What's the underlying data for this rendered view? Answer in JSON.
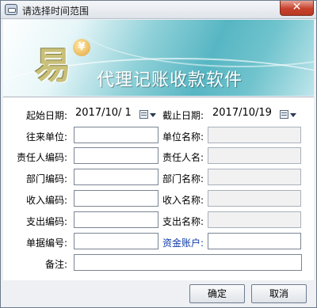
{
  "window": {
    "title": "请选择时间范围",
    "close_label": "✕"
  },
  "banner": {
    "logo_glyph": "易",
    "coin_glyph": "¥",
    "product_name": "代理记账收款软件"
  },
  "form": {
    "start_date_label": "起始日期:",
    "start_date_value": "2017/10/ 1",
    "end_date_label": "截止日期:",
    "end_date_value": "2017/10/19",
    "contact_unit_label": "往来单位:",
    "contact_unit_value": "",
    "unit_name_label": "单位名称:",
    "unit_name_value": "",
    "owner_code_label": "责任人编码:",
    "owner_code_value": "",
    "owner_name_label": "责任人名:",
    "owner_name_value": "",
    "dept_code_label": "部门编码:",
    "dept_code_value": "",
    "dept_name_label": "部门名称:",
    "dept_name_value": "",
    "income_code_label": "收入编码:",
    "income_code_value": "",
    "income_name_label": "收入名称:",
    "income_name_value": "",
    "expense_code_label": "支出编码:",
    "expense_code_value": "",
    "expense_name_label": "支出名称:",
    "expense_name_value": "",
    "doc_no_label": "单据编号:",
    "doc_no_value": "",
    "fund_account_label": "资金账户:",
    "fund_account_value": "",
    "remark_label": "备注:",
    "remark_value": ""
  },
  "buttons": {
    "ok": "确定",
    "cancel": "取消"
  },
  "icons": {
    "app": "app-icon",
    "calendar": "calendar-icon",
    "dropdown": "chevron-down-icon"
  },
  "colors": {
    "link_label": "#0f3ba8",
    "close_button": "#c7412b",
    "banner_teal": "#57b6c3"
  }
}
